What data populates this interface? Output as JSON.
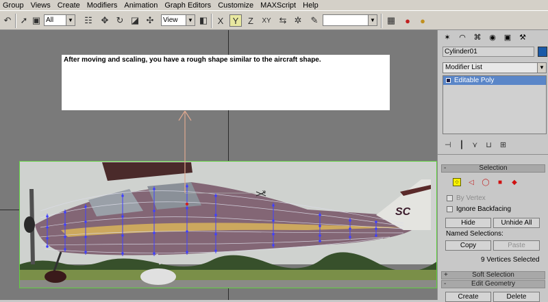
{
  "menu": [
    "Group",
    "Views",
    "Create",
    "Modifiers",
    "Animation",
    "Graph Editors",
    "Customize",
    "MAXScript",
    "Help"
  ],
  "toolbar": {
    "selection_filter": "All",
    "reference_coord": "View",
    "named_selection": "",
    "constraint_labels": [
      "X",
      "Y",
      "Z",
      "XY"
    ]
  },
  "viewport": {
    "note": "After moving and scaling, you have a rough shape similar to the aircraft shape.",
    "gizmo_x_label": "x"
  },
  "panel": {
    "object_name": "Cylinder01",
    "object_color": "#1a5aa8",
    "modifier_list": "Modifier List",
    "stack_items": [
      "Editable Poly"
    ],
    "selection": {
      "title": "Selection",
      "by_vertex": "By Vertex",
      "ignore_backfacing": "Ignore Backfacing",
      "hide": "Hide",
      "unhide_all": "Unhide All",
      "named_selections": "Named Selections:",
      "copy": "Copy",
      "paste": "Paste",
      "status": "9 Vertices Selected"
    },
    "soft_selection": "Soft Selection",
    "edit_geometry": "Edit Geometry",
    "create": "Create",
    "delete": "Delete",
    "rollout_minus": "-",
    "rollout_plus": "+"
  },
  "colors": {
    "highlight": "#5a86c8",
    "vertex_marker": "#4040ff",
    "selection_box": "#60d040"
  }
}
